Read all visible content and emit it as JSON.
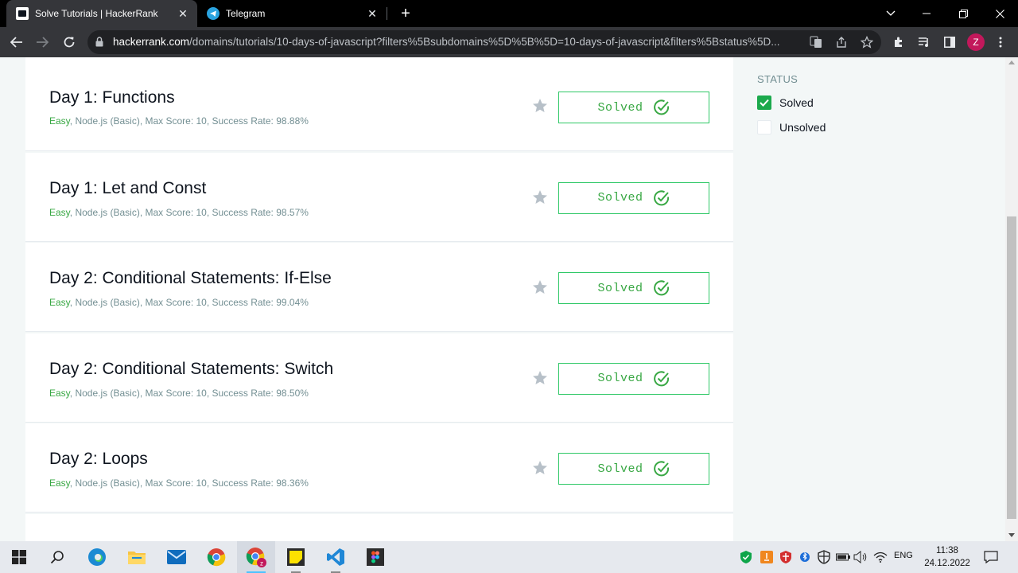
{
  "browser": {
    "tabs": [
      {
        "title": "Solve Tutorials | HackerRank",
        "active": true
      },
      {
        "title": "Telegram",
        "active": false
      }
    ],
    "url_host": "hackerrank.com",
    "url_path": "/domains/tutorials/10-days-of-javascript?filters%5Bsubdomains%5D%5B%5D=10-days-of-javascript&filters%5Bstatus%5D...",
    "profile_initial": "Z"
  },
  "challenges": [
    {
      "title": "Day 1: Functions",
      "difficulty": "Easy",
      "details": ", Node.js (Basic), Max Score: 10, Success Rate: 98.88%",
      "status": "Solved"
    },
    {
      "title": "Day 1: Let and Const",
      "difficulty": "Easy",
      "details": ", Node.js (Basic), Max Score: 10, Success Rate: 98.57%",
      "status": "Solved"
    },
    {
      "title": "Day 2: Conditional Statements: If-Else",
      "difficulty": "Easy",
      "details": ", Node.js (Basic), Max Score: 10, Success Rate: 99.04%",
      "status": "Solved"
    },
    {
      "title": "Day 2: Conditional Statements: Switch",
      "difficulty": "Easy",
      "details": ", Node.js (Basic), Max Score: 10, Success Rate: 98.50%",
      "status": "Solved"
    },
    {
      "title": "Day 2: Loops",
      "difficulty": "Easy",
      "details": ", Node.js (Basic), Max Score: 10, Success Rate: 98.36%",
      "status": "Solved"
    }
  ],
  "filters": {
    "title": "STATUS",
    "options": [
      {
        "label": "Solved",
        "checked": true
      },
      {
        "label": "Unsolved",
        "checked": false
      }
    ]
  },
  "taskbar": {
    "language": "ENG",
    "time": "11:38",
    "date": "24.12.2022"
  },
  "colors": {
    "accent_green": "#39a844",
    "checkbox_green": "#1ba94c",
    "meta_gray": "#738f93"
  }
}
